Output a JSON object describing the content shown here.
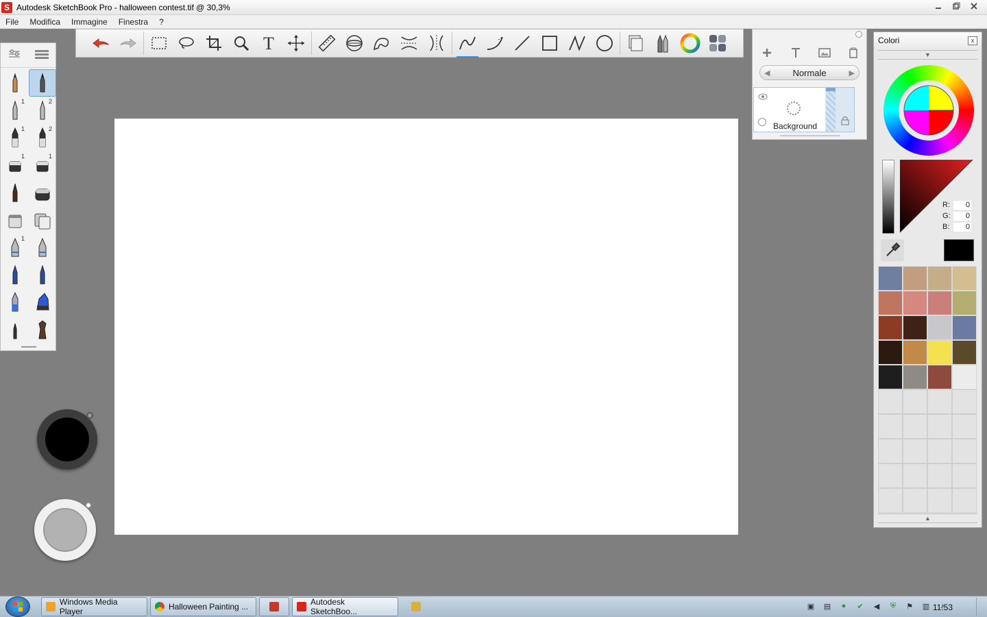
{
  "window": {
    "title": "Autodesk SketchBook Pro - halloween contest.tif @ 30,3%",
    "logo_letter": "S",
    "controls": [
      "minimize-icon",
      "maximize-icon",
      "close-icon"
    ]
  },
  "menu": [
    "File",
    "Modifica",
    "Immagine",
    "Finestra",
    "?"
  ],
  "toolbar": {
    "tools": [
      "undo-icon",
      "redo-icon",
      "rectangle-select-icon",
      "lasso-icon",
      "crop-icon",
      "zoom-icon",
      "text-icon",
      "move-icon",
      "ruler-icon",
      "ellipse-guide-icon",
      "french-curve-icon",
      "symmetry-x-icon",
      "symmetry-y-icon",
      "freehand-line-icon",
      "curve-line-icon",
      "straight-line-icon",
      "rectangle-icon",
      "polyline-icon",
      "circle-icon",
      "layers-toggle-icon",
      "brushes-toggle-icon",
      "color-wheel-toggle-icon",
      "swatches-toggle-icon"
    ],
    "active_tool": "freehand-line-icon",
    "text_label": "T"
  },
  "brushes": {
    "header": [
      "brush-properties-icon",
      "brush-list-icon"
    ],
    "items": [
      {
        "name": "pencil",
        "num": ""
      },
      {
        "name": "pencil-selected",
        "num": ""
      },
      {
        "name": "ballpoint",
        "num": "1"
      },
      {
        "name": "ballpoint",
        "num": "2"
      },
      {
        "name": "marker",
        "num": "1"
      },
      {
        "name": "marker",
        "num": "2"
      },
      {
        "name": "eraser",
        "num": "1"
      },
      {
        "name": "eraser",
        "num": "1"
      },
      {
        "name": "brush",
        "num": ""
      },
      {
        "name": "soft-eraser",
        "num": ""
      },
      {
        "name": "paint-bucket",
        "num": ""
      },
      {
        "name": "fill-bucket",
        "num": ""
      },
      {
        "name": "airbrush",
        "num": "1"
      },
      {
        "name": "airbrush",
        "num": ""
      },
      {
        "name": "pen",
        "num": ""
      },
      {
        "name": "pen",
        "num": ""
      },
      {
        "name": "chisel",
        "num": ""
      },
      {
        "name": "ink",
        "num": ""
      },
      {
        "name": "paintbrush",
        "num": ""
      },
      {
        "name": "smudge",
        "num": ""
      }
    ]
  },
  "pucks": {
    "color_puck": "#000000",
    "brush_puck": "#b2b2b2"
  },
  "layers": {
    "icons": [
      "add-layer-icon",
      "add-text-icon",
      "add-image-icon",
      "delete-layer-icon"
    ],
    "blend_mode": "Normale",
    "layer_name": "Background"
  },
  "colors": {
    "title": "Colori",
    "close": "x",
    "r_label": "R:",
    "r": "0",
    "g_label": "G:",
    "g": "0",
    "b_label": "B:",
    "b": "0",
    "current": "#000000",
    "swatches": [
      "#6f7fa0",
      "#c39e7e",
      "#c5ad88",
      "#d4bd91",
      "#bf7560",
      "#d48880",
      "#c9807a",
      "#b5ac72",
      "#8c3b25",
      "#402118",
      "#c8c8cc",
      "#6a7aa0",
      "#2b1a10",
      "#c28a48",
      "#f5e04e",
      "#5a4a2a",
      "#1e1e1e",
      "#8e8a86",
      "#8e4a3c",
      "#ececec"
    ],
    "empty_count": 20
  },
  "taskbar": {
    "start_label": "",
    "tasks": [
      {
        "label": "Windows Media Player",
        "color": "#f0a030"
      },
      {
        "label": "Halloween Painting ...",
        "color": "#3a8ed8"
      },
      {
        "label": "",
        "color": "#c0392b"
      },
      {
        "label": "Autodesk SketchBoo...",
        "color": "#d9261c"
      },
      {
        "label": "",
        "color": "#d8b040"
      }
    ],
    "tray_icons": [
      "camera-icon",
      "display-icon",
      "green-circle-icon",
      "check-icon",
      "volume-icon",
      "shield-icon",
      "flag-icon",
      "network-icon",
      "speaker-icon"
    ],
    "clock": "11:53"
  }
}
